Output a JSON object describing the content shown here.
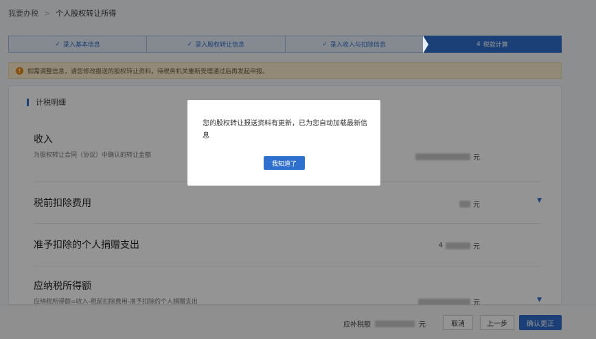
{
  "breadcrumb": {
    "home": "我要办税",
    "sep": ">",
    "current": "个人股权转让所得"
  },
  "steps": [
    {
      "label": "录入基本信息",
      "mark": "✓"
    },
    {
      "label": "录入股权转让信息",
      "mark": "✓"
    },
    {
      "label": "录入收入与扣除信息",
      "mark": "✓"
    },
    {
      "label": "税款计算",
      "mark": "4"
    }
  ],
  "notice": {
    "text": "如需调整信息，请您修改报送的股权转让资料，待税务机关重新受理通过后再发起申报。"
  },
  "section": {
    "title": "计税明细"
  },
  "rows": [
    {
      "label": "收入",
      "desc": "为股权转让合同（协议）中确认的转让金额",
      "unit": "元"
    },
    {
      "label": "税前扣除费用",
      "unit": "元"
    },
    {
      "label": "准予扣除的个人捐赠支出",
      "prefix": "4",
      "unit": "元"
    },
    {
      "label": "应纳税所得额",
      "desc": "应纳税所得额=收入-税前扣除费用-准予扣除的个人捐赠支出",
      "unit": "元"
    }
  ],
  "footer": {
    "tax_label": "应补税额",
    "tax_unit": "元",
    "cancel": "取消",
    "prev": "上一步",
    "confirm": "确认更正"
  },
  "modal": {
    "message": "您的股权转让报送资料有更新，已为您自动加载最新信息",
    "ok": "我知道了"
  },
  "colors": {
    "primary": "#2f6fce",
    "warning": "#e88c18",
    "notice_bg": "#fbeccd"
  }
}
